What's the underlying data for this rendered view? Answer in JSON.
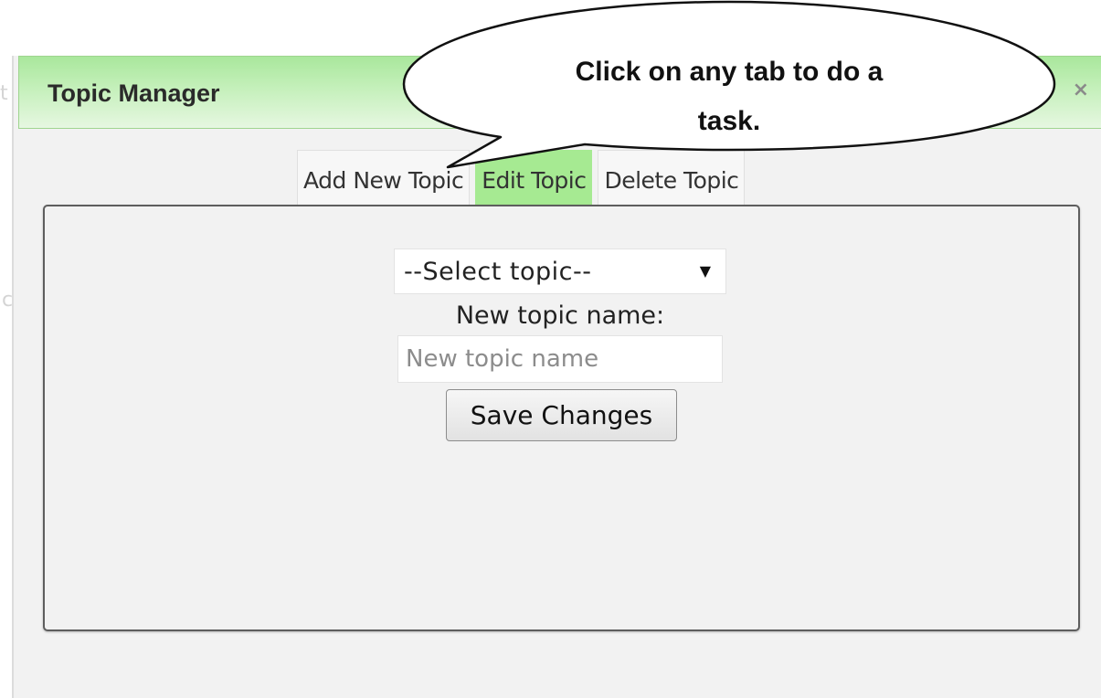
{
  "dialog": {
    "title": "Topic Manager",
    "close_label": "×"
  },
  "tabs": [
    {
      "label": "Add New Topic",
      "active": false
    },
    {
      "label": "Edit Topic",
      "active": true
    },
    {
      "label": "Delete Topic",
      "active": false
    }
  ],
  "form": {
    "select_value": "--Select topic--",
    "new_name_label": "New topic name:",
    "new_name_placeholder": "New topic name",
    "new_name_value": "",
    "save_label": "Save Changes"
  },
  "callout": {
    "line1": "Click on any tab to do a",
    "line2": "task."
  },
  "colors": {
    "titlebar": "#a9e79c",
    "active_tab": "#a6ea92",
    "panel_border": "#5e5e5e"
  },
  "icons": {
    "close": "close-icon",
    "caret": "chevron-down-icon"
  }
}
